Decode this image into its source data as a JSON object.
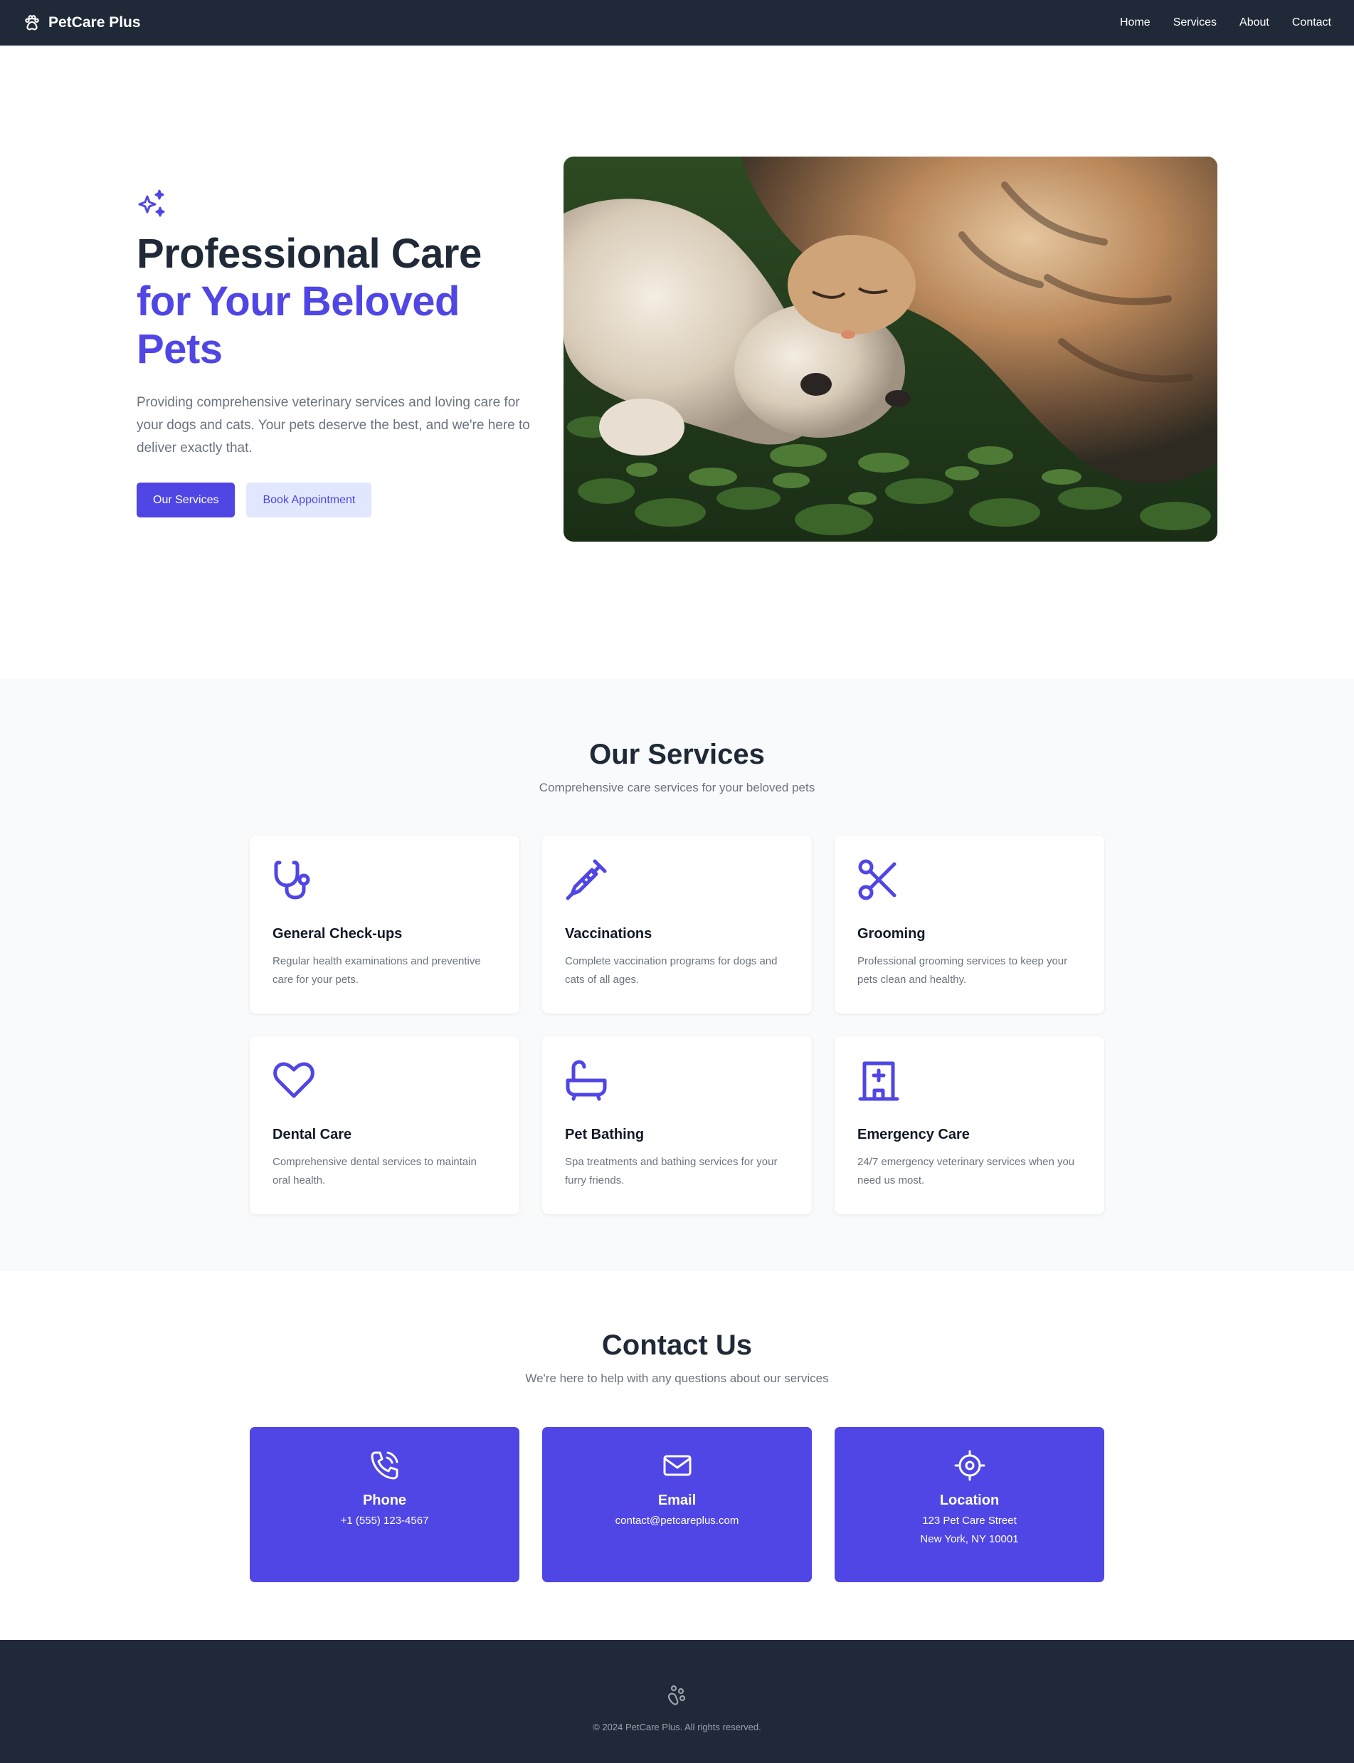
{
  "nav": {
    "brand": "PetCare Plus",
    "links": [
      "Home",
      "Services",
      "About",
      "Contact"
    ]
  },
  "hero": {
    "title_line1": "Professional Care",
    "title_accent": "for Your Beloved Pets",
    "description": "Providing comprehensive veterinary services and loving care for your dogs and cats. Your pets deserve the best, and we're here to deliver exactly that.",
    "primary_btn": "Our Services",
    "secondary_btn": "Book Appointment"
  },
  "services": {
    "title": "Our Services",
    "subtitle": "Comprehensive care services for your beloved pets",
    "items": [
      {
        "icon": "stethoscope-icon",
        "title": "General Check-ups",
        "desc": "Regular health examinations and preventive care for your pets."
      },
      {
        "icon": "syringe-icon",
        "title": "Vaccinations",
        "desc": "Complete vaccination programs for dogs and cats of all ages."
      },
      {
        "icon": "scissors-icon",
        "title": "Grooming",
        "desc": "Professional grooming services to keep your pets clean and healthy."
      },
      {
        "icon": "heart-icon",
        "title": "Dental Care",
        "desc": "Comprehensive dental services to maintain oral health."
      },
      {
        "icon": "bathtub-icon",
        "title": "Pet Bathing",
        "desc": "Spa treatments and bathing services for your furry friends."
      },
      {
        "icon": "hospital-icon",
        "title": "Emergency Care",
        "desc": "24/7 emergency veterinary services when you need us most."
      }
    ]
  },
  "contact": {
    "title": "Contact Us",
    "subtitle": "We're here to help with any questions about our services",
    "items": [
      {
        "icon": "phone-icon",
        "label": "Phone",
        "line1": "+1 (555) 123-4567",
        "line2": ""
      },
      {
        "icon": "mail-icon",
        "label": "Email",
        "line1": "contact@petcareplus.com",
        "line2": ""
      },
      {
        "icon": "location-icon",
        "label": "Location",
        "line1": "123 Pet Care Street",
        "line2": "New York, NY 10001"
      }
    ]
  },
  "footer": {
    "copyright": "© 2024 PetCare Plus. All rights reserved."
  },
  "colors": {
    "accent": "#4f46e5",
    "dark": "#1f2937",
    "light_accent": "#e0e7ff"
  }
}
